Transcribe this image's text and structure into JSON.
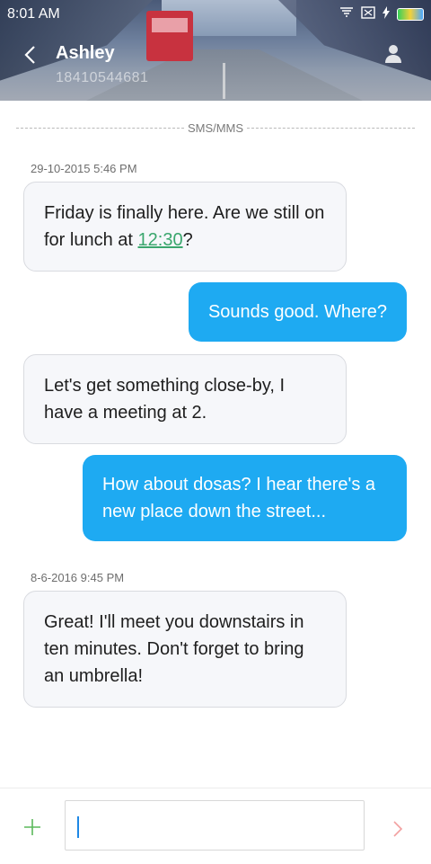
{
  "status_bar": {
    "time": "8:01 AM"
  },
  "contact": {
    "name": "Ashley",
    "number": "18410544681"
  },
  "thread": {
    "channel_label": "SMS/MMS",
    "timestamps": [
      "29-10-2015 5:46 PM",
      "8-6-2016 9:45 PM"
    ],
    "messages": [
      {
        "direction": "incoming",
        "text_before": "Friday is finally here. Are we still on for lunch at ",
        "link": "12:30",
        "text_after": "?"
      },
      {
        "direction": "outgoing",
        "text": "Sounds good. Where?"
      },
      {
        "direction": "incoming",
        "text": "Let's get something close-by, I have a meeting at 2."
      },
      {
        "direction": "outgoing",
        "text": "How about dosas? I hear there's a new place down the street..."
      },
      {
        "direction": "incoming",
        "text": "Great! I'll meet you downstairs in ten minutes. Don't forget to bring an umbrella!"
      }
    ]
  },
  "compose": {
    "value": "",
    "placeholder": ""
  },
  "icons": {
    "back": "chevron-left-icon",
    "contact": "person-icon",
    "add": "plus-icon",
    "send": "chevron-right-icon",
    "signal": "signal-icon",
    "sim": "sim-icon",
    "charging": "bolt-icon",
    "battery": "battery-icon"
  },
  "colors": {
    "outgoing_bubble": "#1eaaf2",
    "incoming_bubble": "#f6f7fa",
    "link": "#3aa66d",
    "plus_icon": "#5cb85c",
    "send_icon": "#f2a0a0",
    "cursor": "#1e88e5"
  }
}
